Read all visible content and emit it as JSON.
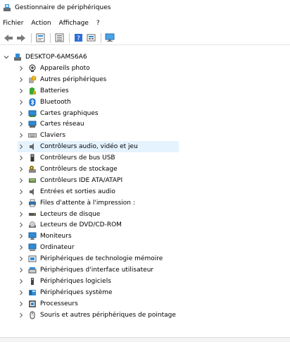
{
  "window": {
    "title": "Gestionnaire de périphériques"
  },
  "menu": [
    "Fichier",
    "Action",
    "Affichage",
    "?"
  ],
  "toolbar": {
    "buttons": [
      "back-arrow-icon",
      "forward-arrow-icon",
      "properties-icon",
      "list-view-icon",
      "help-icon",
      "scan-hardware-icon",
      "monitor-icon"
    ]
  },
  "tree": {
    "root": "DESKTOP-6AMS6A6",
    "items": [
      {
        "label": "Appareils photo",
        "icon": "camera-icon",
        "color": "#444444"
      },
      {
        "label": "Autres périphériques",
        "icon": "unknown-device-icon",
        "color": "#d9a400"
      },
      {
        "label": "Batteries",
        "icon": "battery-icon",
        "color": "#3aa832"
      },
      {
        "label": "Bluetooth",
        "icon": "bluetooth-icon",
        "color": "#1e73d6"
      },
      {
        "label": "Cartes graphiques",
        "icon": "display-adapter-icon",
        "color": "#2e8bd6"
      },
      {
        "label": "Cartes réseau",
        "icon": "network-adapter-icon",
        "color": "#2e8bd6"
      },
      {
        "label": "Claviers",
        "icon": "keyboard-icon",
        "color": "#777777"
      },
      {
        "label": "Contrôleurs audio, vidéo et jeu",
        "icon": "speaker-icon",
        "color": "#666666",
        "selected": true
      },
      {
        "label": "Contrôleurs de bus USB",
        "icon": "usb-icon",
        "color": "#333333"
      },
      {
        "label": "Contrôleurs de stockage",
        "icon": "storage-controller-icon",
        "color": "#8a6d00"
      },
      {
        "label": "Contrôleurs IDE ATA/ATAPI",
        "icon": "ide-controller-icon",
        "color": "#4a6e2a"
      },
      {
        "label": "Entrées et sorties audio",
        "icon": "audio-io-icon",
        "color": "#666666"
      },
      {
        "label": "Files d'attente à l'impression :",
        "icon": "printer-icon",
        "color": "#2e6fb0"
      },
      {
        "label": "Lecteurs de disque",
        "icon": "disk-drive-icon",
        "color": "#555555"
      },
      {
        "label": "Lecteurs de DVD/CD-ROM",
        "icon": "dvd-drive-icon",
        "color": "#777777"
      },
      {
        "label": "Moniteurs",
        "icon": "monitor-icon",
        "color": "#2e8bd6"
      },
      {
        "label": "Ordinateur",
        "icon": "computer-icon",
        "color": "#2e8bd6"
      },
      {
        "label": "Périphériques de technologie mémoire",
        "icon": "memory-device-icon",
        "color": "#555555"
      },
      {
        "label": "Périphériques d'interface utilisateur",
        "icon": "hid-icon",
        "color": "#555555"
      },
      {
        "label": "Périphériques logiciels",
        "icon": "software-device-icon",
        "color": "#444444"
      },
      {
        "label": "Périphériques système",
        "icon": "system-device-icon",
        "color": "#2e8bd6"
      },
      {
        "label": "Processeurs",
        "icon": "processor-icon",
        "color": "#333333"
      },
      {
        "label": "Souris et autres périphériques de pointage",
        "icon": "mouse-icon",
        "color": "#444444"
      }
    ]
  },
  "colors": {
    "selection": "#e5f3ff",
    "accent": "#2e8bd6"
  }
}
